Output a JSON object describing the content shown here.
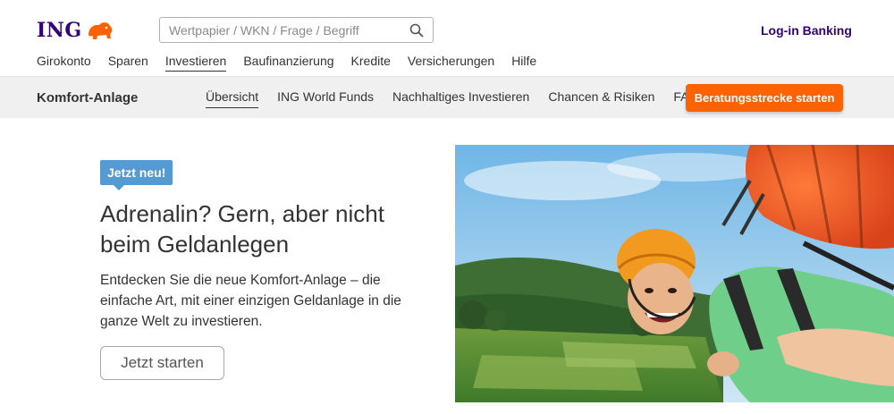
{
  "header": {
    "logo_text": "ING",
    "search_placeholder": "Wertpapier / WKN / Frage / Begriff",
    "login_label": "Log-in Banking"
  },
  "main_nav": {
    "items": [
      {
        "label": "Girokonto"
      },
      {
        "label": "Sparen"
      },
      {
        "label": "Investieren",
        "active": true
      },
      {
        "label": "Baufinanzierung"
      },
      {
        "label": "Kredite"
      },
      {
        "label": "Versicherungen"
      },
      {
        "label": "Hilfe"
      }
    ]
  },
  "sub_nav": {
    "title": "Komfort-Anlage",
    "items": [
      {
        "label": "Übersicht",
        "active": true
      },
      {
        "label": "ING World Funds"
      },
      {
        "label": "Nachhaltiges Investieren"
      },
      {
        "label": "Chancen & Risiken"
      },
      {
        "label": "FAQ"
      }
    ],
    "cta_label": "Beratungsstrecke starten"
  },
  "hero": {
    "badge": "Jetzt neu!",
    "title": "Adrenalin? Gern, aber nicht beim Geldanlegen",
    "text": "Entdecken Sie die neue Komfort-Anlage – die einfache Art, mit einer einzigen Geldanlage in die ganze Welt zu investieren.",
    "button_label": "Jetzt starten"
  },
  "colors": {
    "brand": "#33007a",
    "accent": "#ff6200",
    "badge": "#559bd1"
  },
  "icons": [
    "lion-logo-icon",
    "search-icon"
  ]
}
